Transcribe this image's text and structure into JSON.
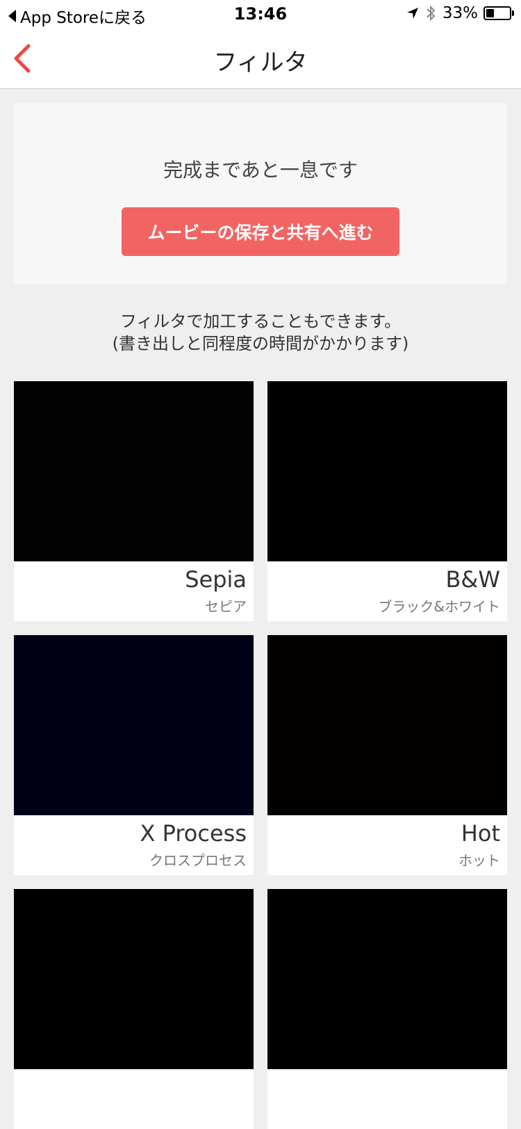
{
  "status_bar": {
    "back_app": "App Storeに戻る",
    "time": "13:46",
    "battery": "33%",
    "battery_level": 0.33
  },
  "nav": {
    "title": "フィルタ",
    "back_icon": "chevron-left-icon",
    "accent_color": "#f04646"
  },
  "card": {
    "message": "完成まであと一息です",
    "button_label": "ムービーの保存と共有へ進む",
    "button_color": "#f26462"
  },
  "info": {
    "line1": "フィルタで加工することもできます。",
    "line2": "(書き出しと同程度の時間がかかります)"
  },
  "filters": [
    {
      "name": "Sepia",
      "subtitle": "セピア",
      "preview_color": "#020202"
    },
    {
      "name": "B&W",
      "subtitle": "ブラック&ホワイト",
      "preview_color": "#000000"
    },
    {
      "name": "X Process",
      "subtitle": "クロスプロセス",
      "preview_color": "#000018"
    },
    {
      "name": "Hot",
      "subtitle": "ホット",
      "preview_color": "#020100"
    },
    {
      "name": "",
      "subtitle": "",
      "preview_color": "#000000"
    },
    {
      "name": "",
      "subtitle": "",
      "preview_color": "#000000"
    }
  ]
}
